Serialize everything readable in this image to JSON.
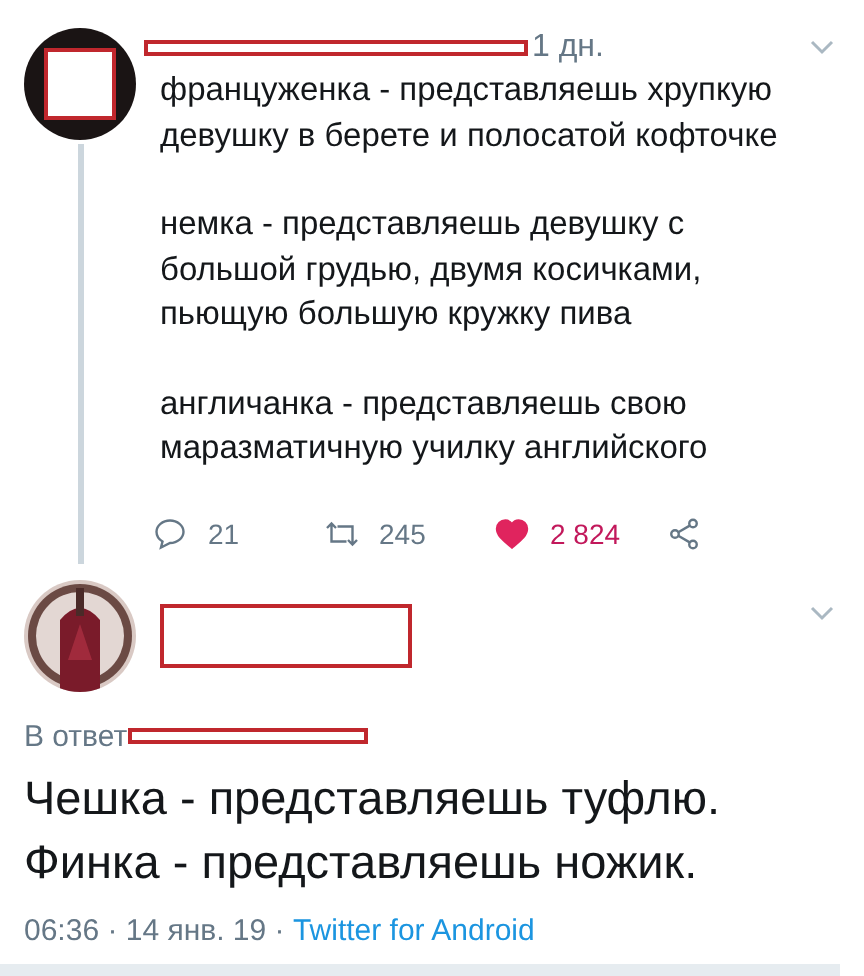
{
  "reply_tweet": {
    "author": {
      "redacted": true
    },
    "time": "1 дн.",
    "paragraphs": [
      "француженка - представляешь хрупкую девушку в берете и полосатой кофточке",
      "немка - представляешь девушку с большой грудью, двумя косичками, пьющую большую кружку пива",
      "англичанка - представляешь свою маразматичную училку английского"
    ],
    "actions": [
      {
        "kind": "reply",
        "count": "21"
      },
      {
        "kind": "retweet",
        "count": "245"
      },
      {
        "kind": "like",
        "count": "2 824",
        "liked": true
      },
      {
        "kind": "share"
      }
    ]
  },
  "main_tweet": {
    "author": {
      "redacted": true
    },
    "avatar": {
      "kind": "picture"
    },
    "reply_to": {
      "label": "В ответ",
      "redacted": true
    },
    "lines": [
      "Чешка - представляешь туфлю.",
      "Финка - представляешь ножик."
    ],
    "timestamp": "06:36 · 14 янв. 19 · ",
    "source": "Twitter for Android"
  }
}
